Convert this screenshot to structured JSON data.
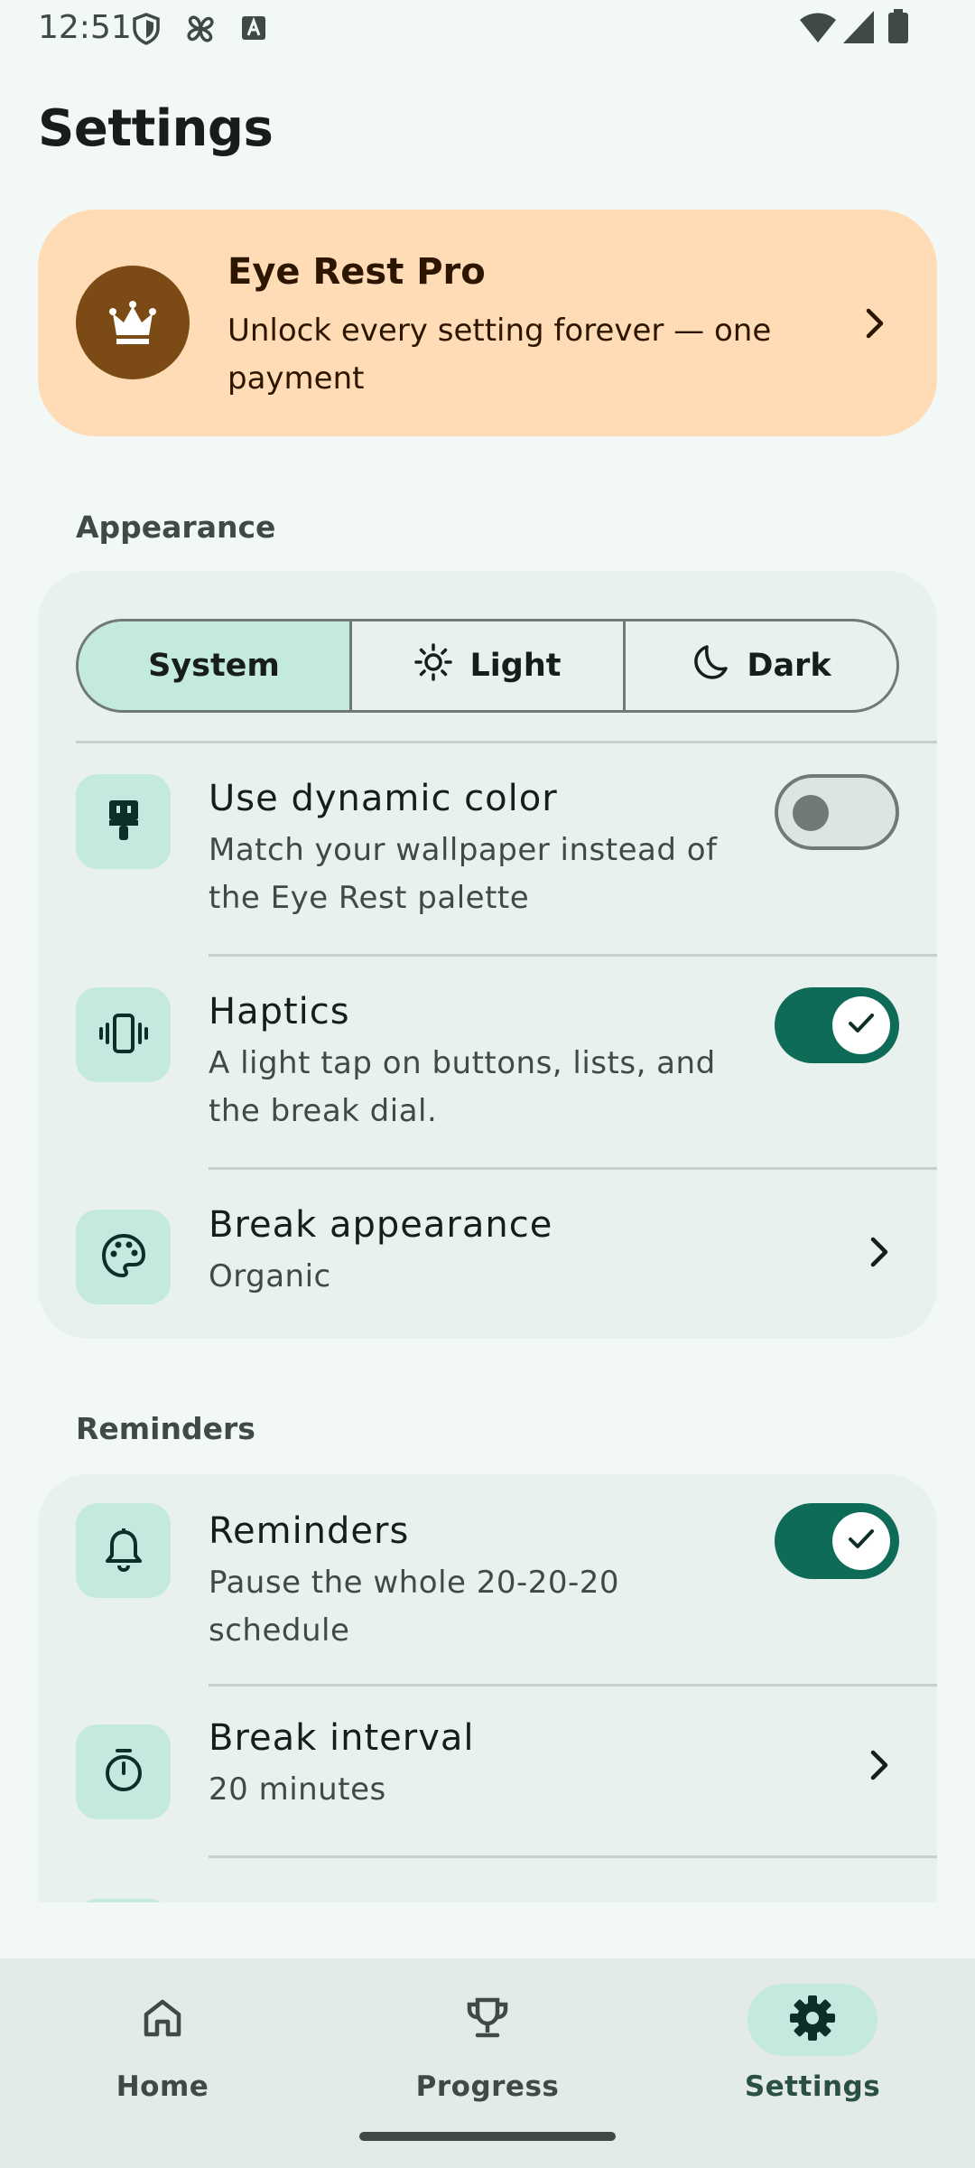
{
  "status_bar": {
    "time": "12:51",
    "left_icons": [
      "shield-icon",
      "pinwheel-icon",
      "font-a-icon"
    ],
    "right_icons": [
      "wifi-icon",
      "signal-icon",
      "battery-icon"
    ]
  },
  "page": {
    "title": "Settings"
  },
  "pro": {
    "title": "Eye Rest Pro",
    "subtitle": "Unlock every setting forever — one payment",
    "icon": "crown-icon",
    "badge_color": "#7b4a15",
    "card_color": "#ffdcb6"
  },
  "appearance": {
    "section_label": "Appearance",
    "theme_options": [
      {
        "label": "System",
        "icon": "check-icon",
        "selected": true
      },
      {
        "label": "Light",
        "icon": "sun-icon",
        "selected": false
      },
      {
        "label": "Dark",
        "icon": "moon-icon",
        "selected": false
      }
    ],
    "rows": [
      {
        "title": "Use dynamic color",
        "subtitle": "Match your wallpaper instead of the Eye Rest palette",
        "icon": "paint-brush-icon",
        "control": "toggle",
        "on": false
      },
      {
        "title": "Haptics",
        "subtitle": "A light tap on buttons, lists, and the break dial.",
        "icon": "vibration-icon",
        "control": "toggle",
        "on": true
      },
      {
        "title": "Break appearance",
        "subtitle": "Organic",
        "icon": "palette-icon",
        "control": "chevron"
      }
    ]
  },
  "reminders": {
    "section_label": "Reminders",
    "rows": [
      {
        "title": "Reminders",
        "subtitle": "Pause the whole 20-20-20 schedule",
        "icon": "bell-icon",
        "control": "toggle",
        "on": true
      },
      {
        "title": "Break interval",
        "subtitle": "20 minutes",
        "icon": "timer-icon",
        "control": "chevron"
      }
    ]
  },
  "nav": {
    "items": [
      {
        "label": "Home",
        "icon": "home-icon",
        "active": false
      },
      {
        "label": "Progress",
        "icon": "trophy-icon",
        "active": false
      },
      {
        "label": "Settings",
        "icon": "gear-icon",
        "active": true
      }
    ]
  },
  "colors": {
    "background": "#f1f8f5",
    "accent": "#0e6b57",
    "selected_container": "#c4eadf",
    "card": "#e8f1ed"
  }
}
